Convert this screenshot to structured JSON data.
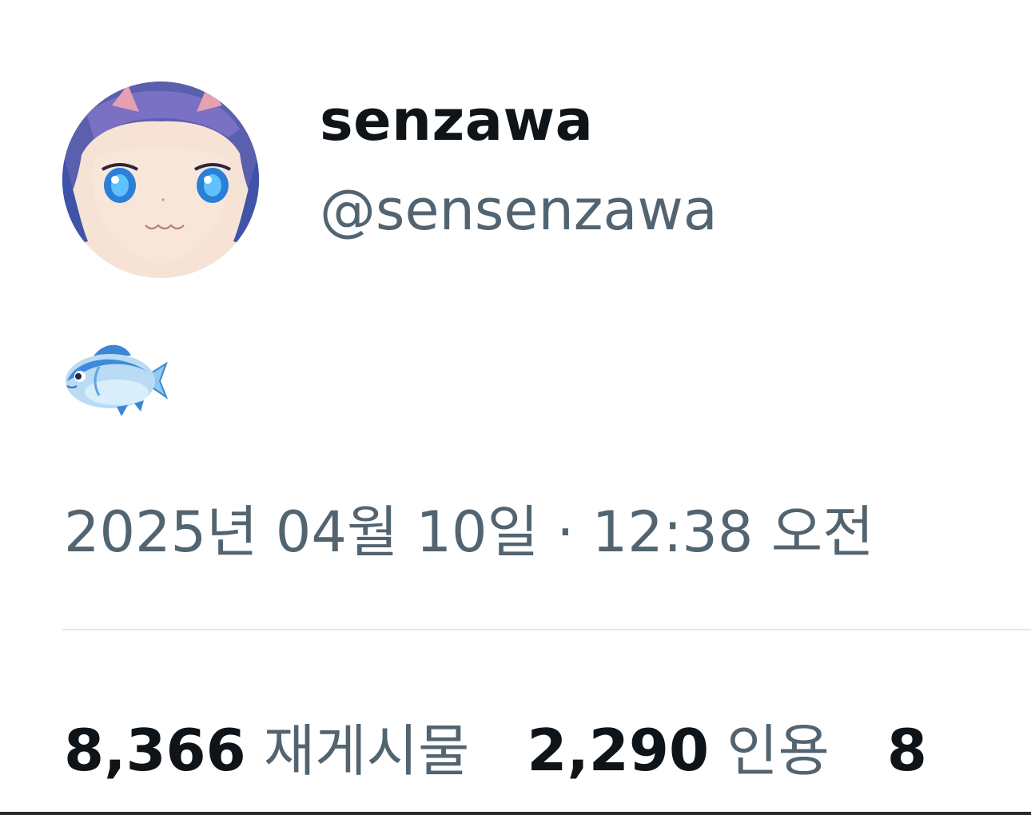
{
  "author": {
    "display_name": "senzawa",
    "handle": "@sensenzawa",
    "avatar_icon": "anime-girl-avatar"
  },
  "tweet": {
    "emoji": "🐟",
    "emoji_icon": "fish-emoji-icon",
    "timestamp": "2025년 04월 10일 · 12:38 오전"
  },
  "stats": [
    {
      "count": "8,366",
      "label": "재게시물"
    },
    {
      "count": "2,290",
      "label": "인용"
    },
    {
      "count": "8",
      "label": ""
    }
  ],
  "colors": {
    "primary_text": "#0f1419",
    "secondary_text": "#536471",
    "divider": "#e4e8ea"
  }
}
